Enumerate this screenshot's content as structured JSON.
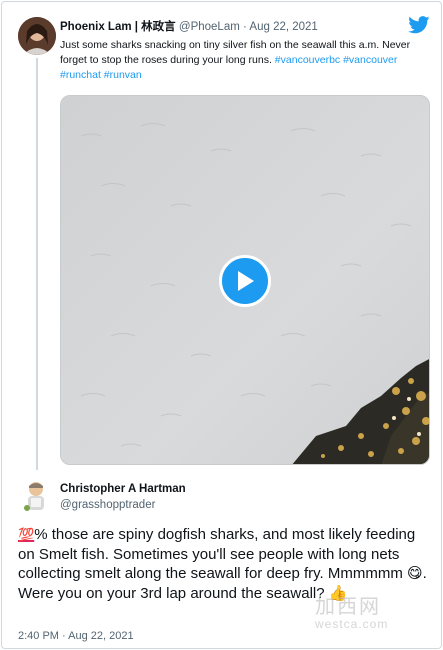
{
  "tweet": {
    "author_name": "Phoenix Lam | 林政言",
    "author_handle": "@PhoeLam",
    "separator": "·",
    "date": "Aug 22, 2021",
    "text_plain": "Just some sharks snacking on tiny silver fish on the seawall this a.m. Never forget to stop the roses during your long runs. ",
    "hashtags": [
      "#vancouverbc",
      "#vancouver",
      "#runchat",
      "#runvan"
    ],
    "media_type": "video",
    "media_action": "play"
  },
  "reply": {
    "author_name": "Christopher A Hartman",
    "author_handle": "@grasshopptrader",
    "text_prefix_emoji": "💯",
    "text_part1": "% those are spiny dogfish sharks,  and most likely feeding on Smelt fish. Sometimes you'll see people with long nets collecting smelt along the seawall for deep fry. Mmmmmm ",
    "emoji_yum": "😋",
    "text_part2": ". Were you on your 3rd lap around the seawall? ",
    "emoji_thumb": "👍",
    "timestamp": "2:40 PM · Aug 22, 2021"
  },
  "watermark": {
    "cn": "加西网",
    "url": "westca.com"
  },
  "icons": {
    "brand": "twitter-bird-icon",
    "play": "play-icon"
  },
  "colors": {
    "link": "#1d9bf0",
    "play_button": "#1d9bf0",
    "hundred_emoji": "#e0245e"
  }
}
